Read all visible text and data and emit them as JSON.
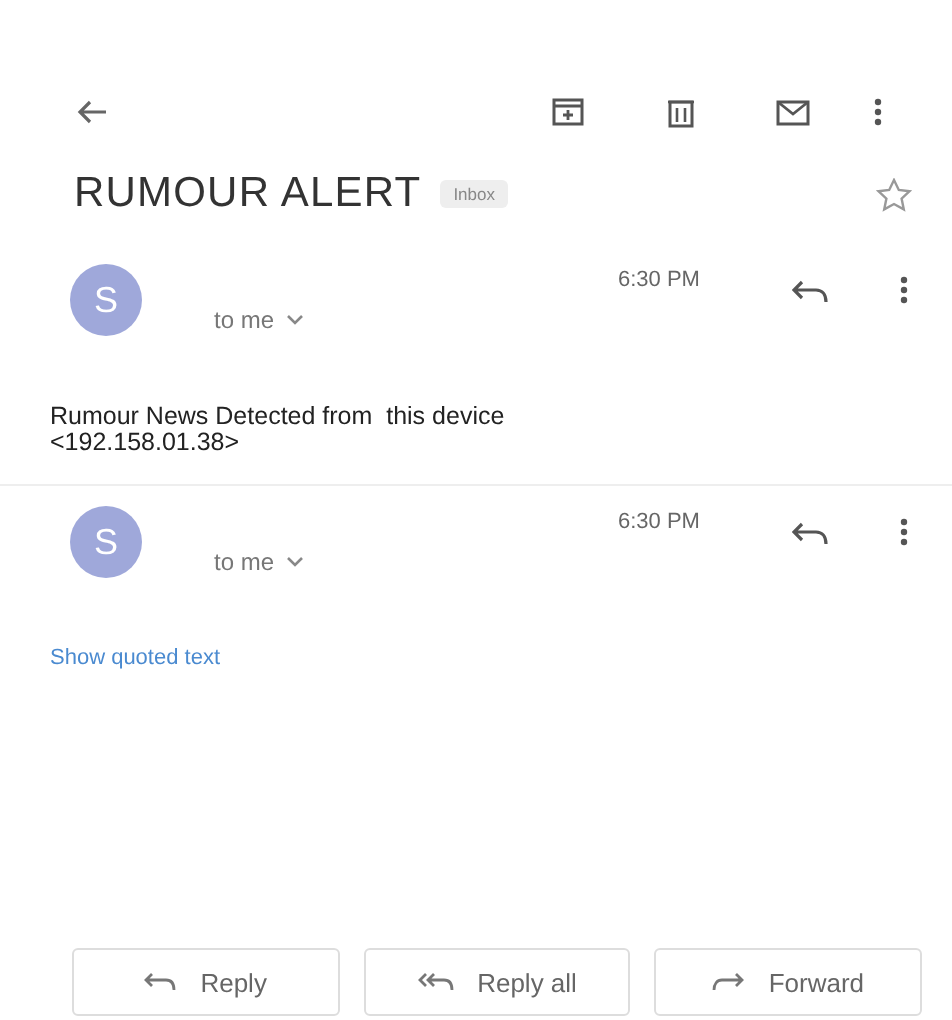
{
  "subject": {
    "title": "RUMOUR ALERT",
    "label": "Inbox",
    "starred": false
  },
  "messages": [
    {
      "avatar": "S",
      "recipient": "to me",
      "time": "6:30 PM",
      "body": "Rumour News Detected from  this device\n<192.158.01.38>"
    },
    {
      "avatar": "S",
      "recipient": "to me",
      "time": "6:30 PM",
      "link": "Show quoted text"
    }
  ],
  "actions": [
    {
      "kind": "reply",
      "label": "Reply"
    },
    {
      "kind": "reply-all",
      "label": "Reply all"
    },
    {
      "kind": "forward",
      "label": "Forward"
    }
  ]
}
